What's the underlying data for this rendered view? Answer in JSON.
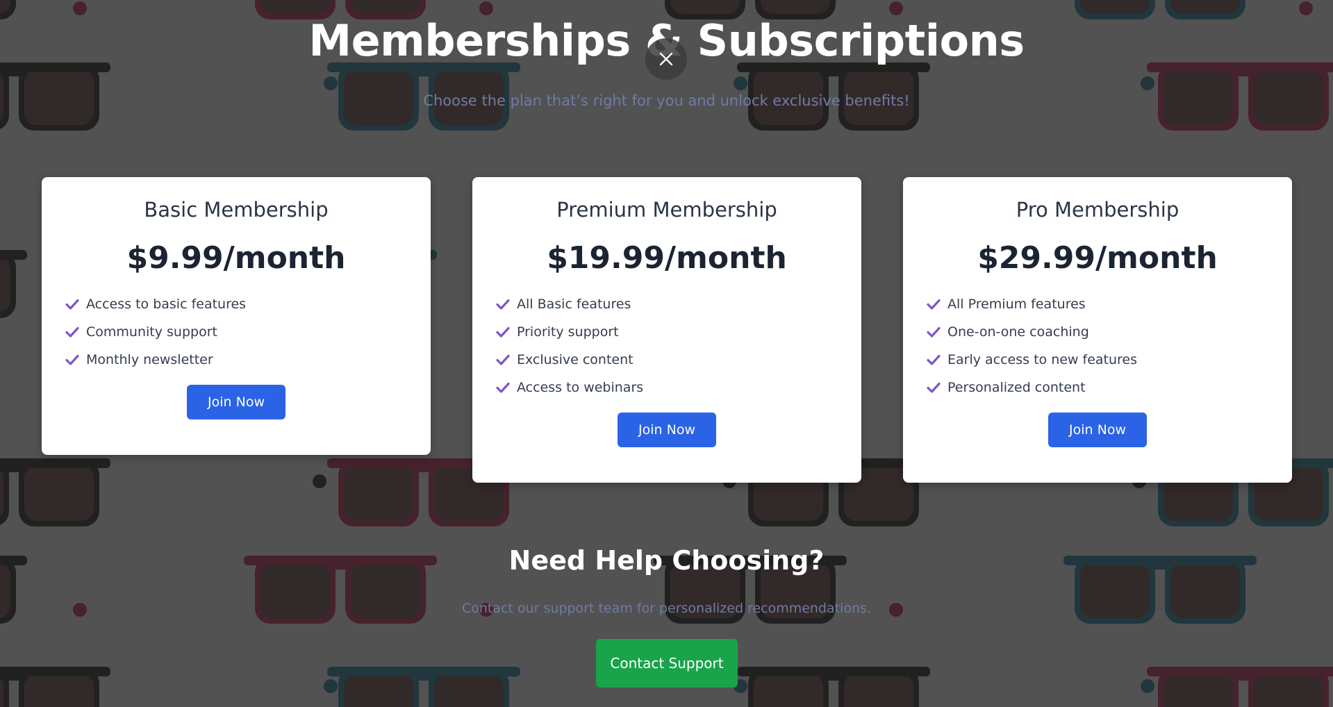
{
  "page": {
    "title": "Memberships & Subscriptions",
    "subtitle": "Choose the plan that’s right for you and unlock exclusive benefits!",
    "close_icon": "close-icon"
  },
  "plans": [
    {
      "name": "Basic Membership",
      "price": "$9.99/month",
      "features": [
        "Access to basic features",
        "Community support",
        "Monthly newsletter"
      ],
      "button_label": "Join Now"
    },
    {
      "name": "Premium Membership",
      "price": "$19.99/month",
      "features": [
        "All Basic features",
        "Priority support",
        "Exclusive content",
        "Access to webinars"
      ],
      "button_label": "Join Now"
    },
    {
      "name": "Pro Membership",
      "price": "$29.99/month",
      "features": [
        "All Premium features",
        "One-on-one coaching",
        "Early access to new features",
        "Personalized content"
      ],
      "button_label": "Join Now"
    }
  ],
  "help": {
    "title": "Need Help Choosing?",
    "text": "Contact our support team for personalized recommendations.",
    "button_label": "Contact Support"
  },
  "colors": {
    "accent_blue": "#2b63e6",
    "success_green": "#19a34a",
    "check_purple": "#7c55c9"
  }
}
